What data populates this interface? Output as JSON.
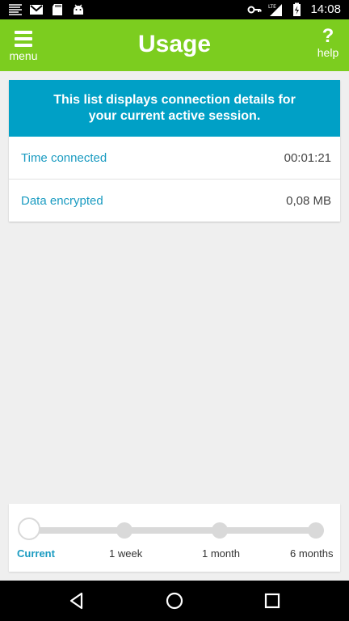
{
  "status_bar": {
    "time": "14:08",
    "left_icons": [
      "notification-stripes-icon",
      "gmail-icon",
      "sd-card-icon",
      "android-icon"
    ],
    "right_icons": [
      "vpn-key-icon",
      "lte-signal-icon",
      "battery-charging-icon"
    ],
    "network_type": "LTE"
  },
  "app_bar": {
    "menu_label": "menu",
    "title": "Usage",
    "help_symbol": "?",
    "help_label": "help",
    "color": "#7ccd1f"
  },
  "info": {
    "message": "This list displays connection details for your current active session.",
    "header_color": "#00a0c6",
    "rows": [
      {
        "label": "Time connected",
        "value": "00:01:21"
      },
      {
        "label": "Data encrypted",
        "value": "0,08 MB"
      }
    ]
  },
  "timeline": {
    "selected": "Current",
    "options": [
      "Current",
      "1 week",
      "1 month",
      "6 months"
    ]
  },
  "nav_bar": {
    "buttons": [
      "back-icon",
      "home-icon",
      "recents-icon"
    ]
  }
}
